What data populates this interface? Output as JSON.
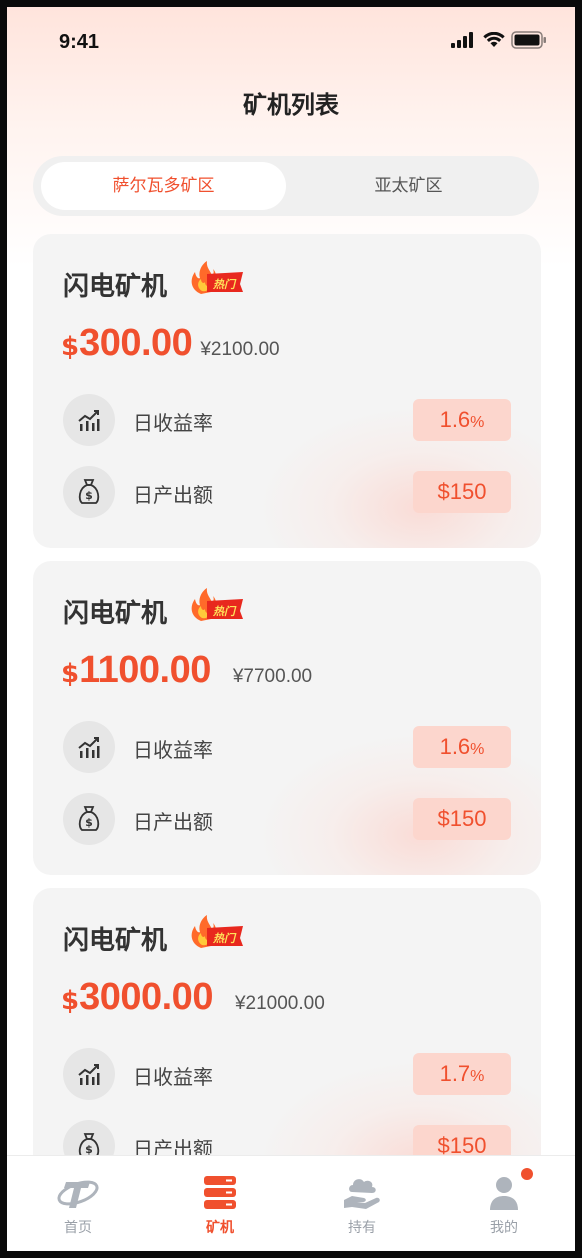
{
  "status_bar": {
    "time": "9:41"
  },
  "page": {
    "title": "矿机列表"
  },
  "tabs": [
    {
      "label": "萨尔瓦多矿区",
      "active": true
    },
    {
      "label": "亚太矿区",
      "active": false
    }
  ],
  "colors": {
    "accent": "#f0502e",
    "badge_bg": "#fcd6cd",
    "card_bg": "#f4f4f4"
  },
  "cards": [
    {
      "name": "闪电矿机",
      "badge": "热门",
      "currency": "$",
      "price": "300.00",
      "price_cny": "¥2100.00",
      "stats": [
        {
          "icon": "chart-icon",
          "label": "日收益率",
          "value": "1.6",
          "unit": "%"
        },
        {
          "icon": "money-bag-icon",
          "label": "日产出额",
          "value": "$150",
          "unit": ""
        }
      ]
    },
    {
      "name": "闪电矿机",
      "badge": "热门",
      "currency": "$",
      "price": "1100.00",
      "price_cny": "¥7700.00",
      "stats": [
        {
          "icon": "chart-icon",
          "label": "日收益率",
          "value": "1.6",
          "unit": "%"
        },
        {
          "icon": "money-bag-icon",
          "label": "日产出额",
          "value": "$150",
          "unit": ""
        }
      ]
    },
    {
      "name": "闪电矿机",
      "badge": "热门",
      "currency": "$",
      "price": "3000.00",
      "price_cny": "¥21000.00",
      "stats": [
        {
          "icon": "chart-icon",
          "label": "日收益率",
          "value": "1.7",
          "unit": "%"
        },
        {
          "icon": "money-bag-icon",
          "label": "日产出额",
          "value": "$150",
          "unit": ""
        }
      ]
    }
  ],
  "nav": [
    {
      "label": "首页",
      "icon": "home-logo-icon",
      "active": false
    },
    {
      "label": "矿机",
      "icon": "server-icon",
      "active": true
    },
    {
      "label": "持有",
      "icon": "hand-cloud-icon",
      "active": false
    },
    {
      "label": "我的",
      "icon": "user-icon",
      "active": false,
      "has_dot": true
    }
  ]
}
